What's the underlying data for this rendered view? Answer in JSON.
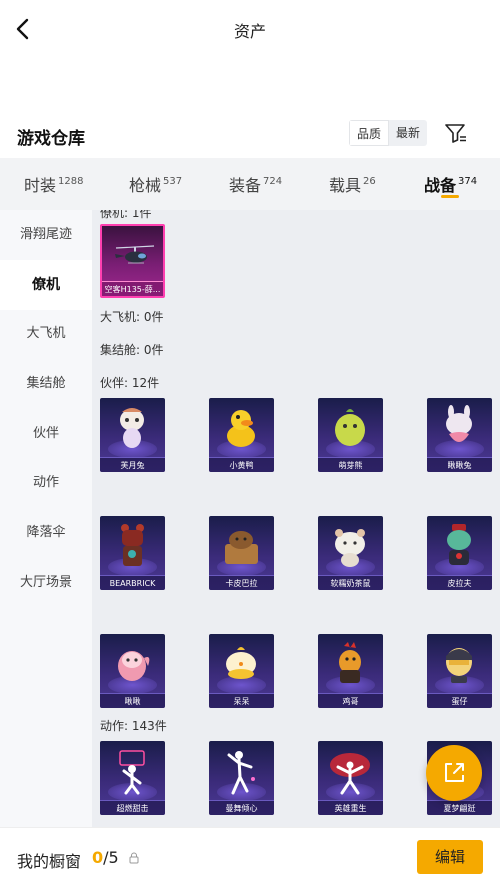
{
  "header": {
    "title": "资产"
  },
  "warehouse": {
    "title": "游戏仓库",
    "sort_options": [
      "品质",
      "最新"
    ]
  },
  "tabs": [
    {
      "label": "时装",
      "count": "1288"
    },
    {
      "label": "枪械",
      "count": "537"
    },
    {
      "label": "装备",
      "count": "724"
    },
    {
      "label": "载具",
      "count": "26"
    },
    {
      "label": "战备",
      "count": "374"
    }
  ],
  "sidebar": [
    "滑翔尾迹",
    "僚机",
    "大飞机",
    "集结舱",
    "伙伴",
    "动作",
    "降落伞",
    "大厅场景"
  ],
  "sections": {
    "wingman": "僚机: 1件",
    "big_plane": "大飞机: 0件",
    "pod": "集结舱: 0件",
    "partner": "伙伴: 12件",
    "action": "动作: 143件"
  },
  "wingman_items": [
    {
      "name": "空客H135-薛..."
    }
  ],
  "partners": [
    {
      "name": "芙月兔"
    },
    {
      "name": "小黄鸭"
    },
    {
      "name": "萌芽熊"
    },
    {
      "name": "瞅瞅兔"
    },
    {
      "name": "BEARBRICK"
    },
    {
      "name": "卡皮巴拉"
    },
    {
      "name": "软糯奶茶鼠"
    },
    {
      "name": "皮拉夫"
    },
    {
      "name": "啾啾"
    },
    {
      "name": "呆呆"
    },
    {
      "name": "鸡哥"
    },
    {
      "name": "蛋仔"
    }
  ],
  "actions": [
    {
      "name": "超燃甜击"
    },
    {
      "name": "曼舞倾心"
    },
    {
      "name": "英雄重生"
    },
    {
      "name": "夏梦翩跹"
    }
  ],
  "bottom": {
    "label": "我的橱窗",
    "current": "0",
    "total": "/5",
    "edit": "编辑"
  },
  "colors": {
    "accent": "#f5a900",
    "card_bg": "#2d2563",
    "selected_card_border": "#ff3fb0"
  },
  "icons": {
    "back": "chevron-left-icon",
    "filter": "filter-icon",
    "share": "share-external-icon",
    "lock": "lock-icon"
  }
}
